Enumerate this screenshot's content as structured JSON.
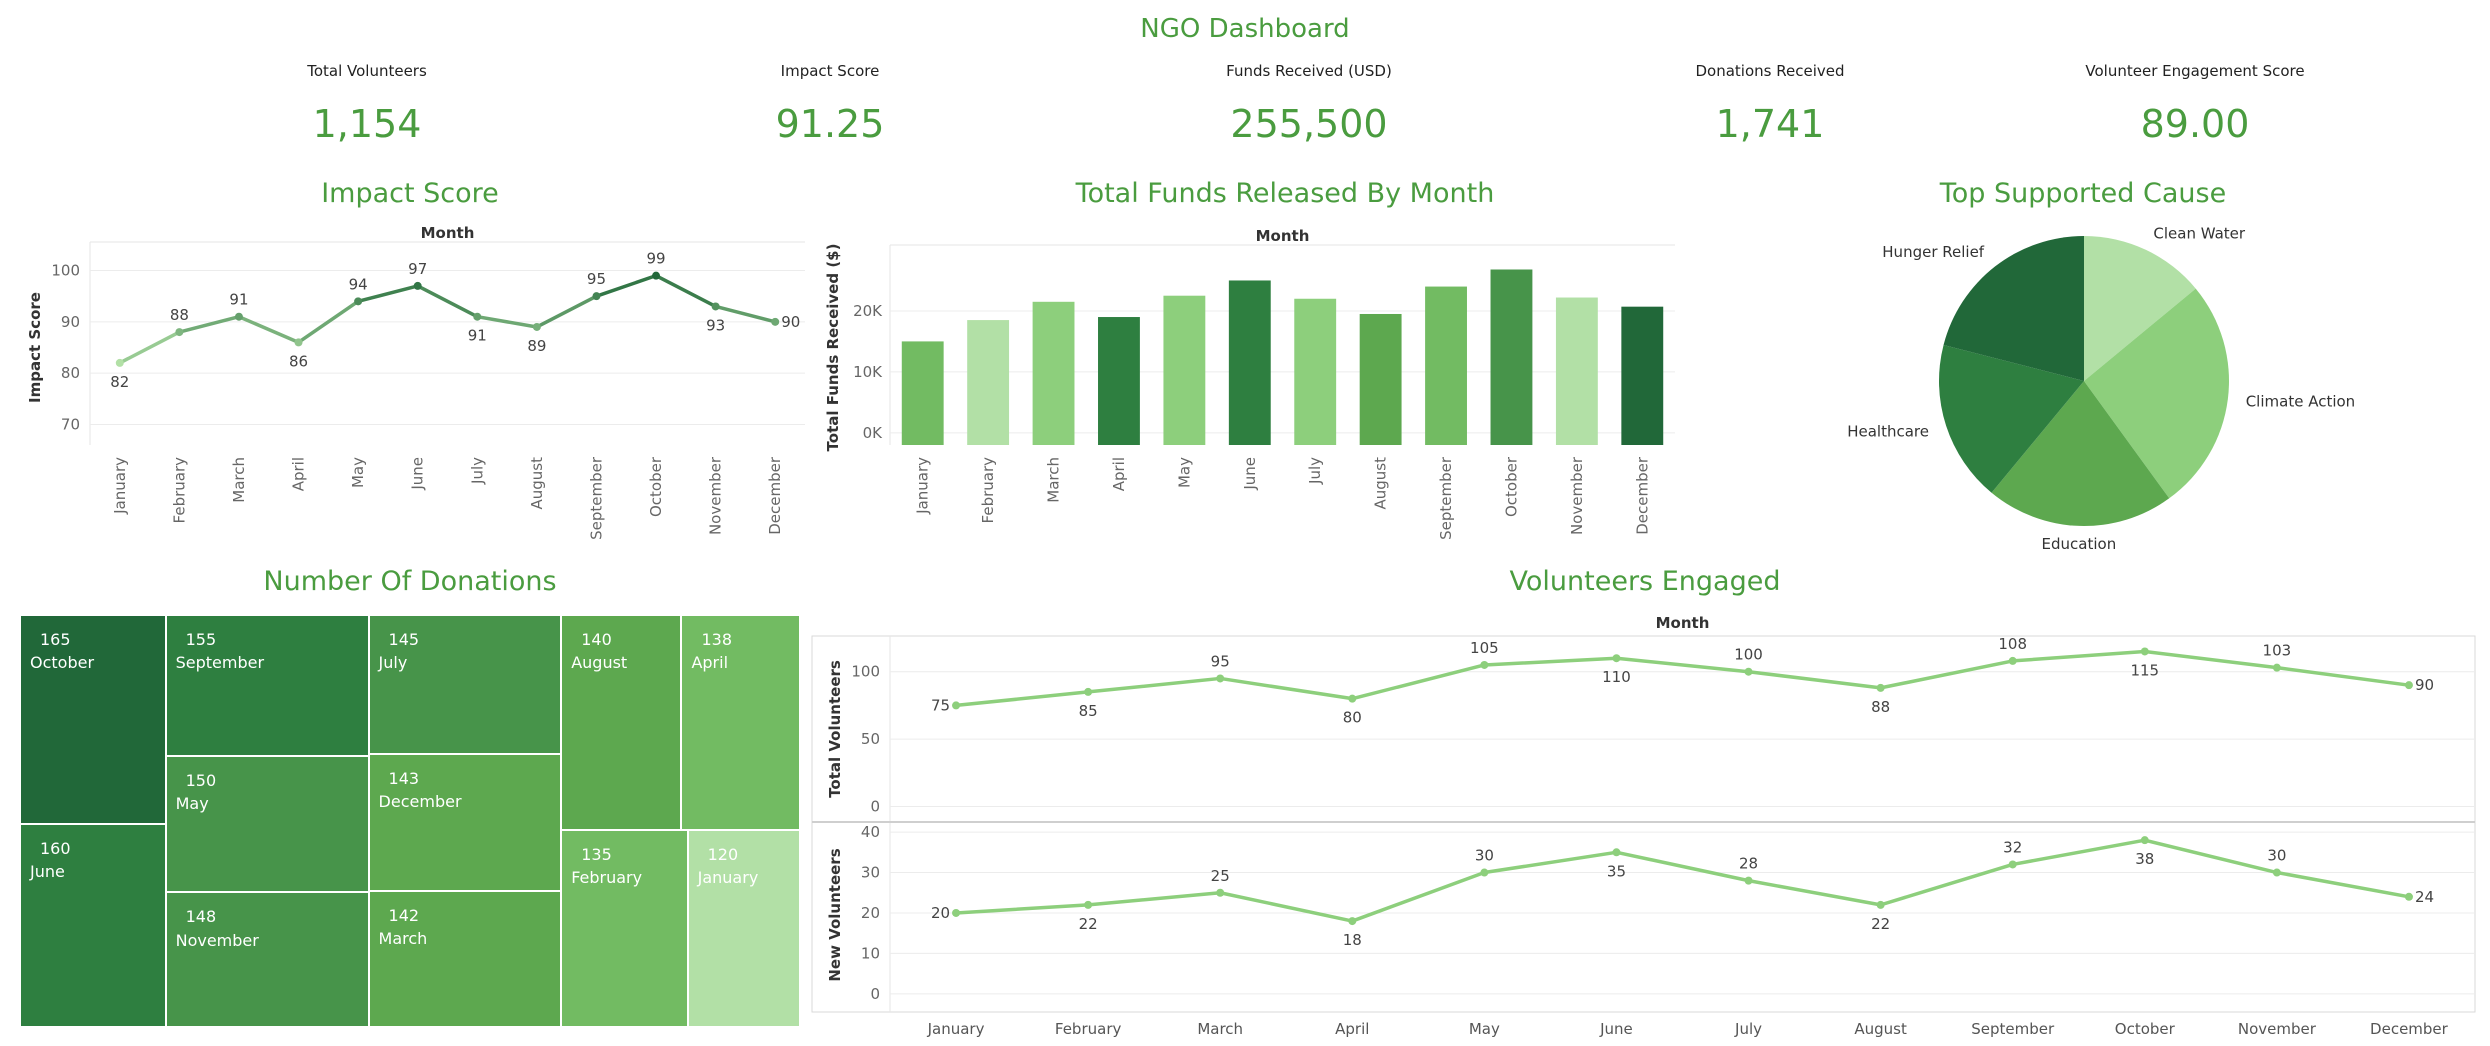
{
  "dashboard": {
    "title": "NGO Dashboard"
  },
  "kpis": [
    {
      "label": "Total Volunteers",
      "value": "1,154"
    },
    {
      "label": "Impact Score",
      "value": "91.25"
    },
    {
      "label": "Funds Received (USD)",
      "value": "255,500"
    },
    {
      "label": "Donations Received",
      "value": "1,741"
    },
    {
      "label": "Volunteer Engagement Score",
      "value": "89.00"
    }
  ],
  "palette": {
    "accent": "#4a9c3f",
    "g1": "#b2e0a6",
    "g2": "#8dcf7c",
    "g3": "#72bb62",
    "g4": "#5da84f",
    "g5": "#47944a",
    "g6": "#2e7f40",
    "g7": "#216839"
  },
  "chart_data": [
    {
      "id": "impact",
      "type": "line",
      "title": "Impact Score",
      "xlabel": "Month",
      "ylabel": "Impact Score",
      "categories": [
        "January",
        "February",
        "March",
        "April",
        "May",
        "June",
        "July",
        "August",
        "September",
        "October",
        "November",
        "December"
      ],
      "values": [
        82,
        88,
        91,
        86,
        94,
        97,
        91,
        89,
        95,
        99,
        93,
        90
      ],
      "ylim": [
        66,
        104
      ],
      "yticks": [
        70,
        80,
        90,
        100
      ],
      "grid": true
    },
    {
      "id": "funds",
      "type": "bar",
      "title": "Total Funds Released By Month",
      "xlabel": "Month",
      "ylabel": "Total Funds Received ($)",
      "categories": [
        "January",
        "February",
        "March",
        "April",
        "May",
        "June",
        "July",
        "August",
        "September",
        "October",
        "November",
        "December"
      ],
      "values": [
        15000,
        18500,
        21500,
        19000,
        22500,
        25000,
        22000,
        19500,
        24000,
        26800,
        22200,
        20700
      ],
      "ylim": [
        -2000,
        30000
      ],
      "yticks": [
        0,
        10000,
        20000
      ],
      "ytick_labels": [
        "0K",
        "10K",
        "20K"
      ],
      "colors": [
        "#72bb62",
        "#b2e0a6",
        "#8dcf7c",
        "#2e7f40",
        "#8dcf7c",
        "#2e7f40",
        "#8dcf7c",
        "#5da84f",
        "#72bb62",
        "#47944a",
        "#b2e0a6",
        "#216839"
      ]
    },
    {
      "id": "cause",
      "type": "pie",
      "title": "Top Supported Cause",
      "slices": [
        {
          "label": "Clean Water",
          "value": 14,
          "color": "#b2e0a6"
        },
        {
          "label": "Climate Action",
          "value": 26,
          "color": "#8dcf7c"
        },
        {
          "label": "Education",
          "value": 21,
          "color": "#5da84f"
        },
        {
          "label": "Healthcare",
          "value": 18,
          "color": "#2e7f40"
        },
        {
          "label": "Hunger Relief",
          "value": 21,
          "color": "#216839"
        }
      ]
    },
    {
      "id": "donations",
      "type": "treemap",
      "title": "Number Of Donations",
      "items": [
        {
          "label": "October",
          "value": 165,
          "color": "#216839"
        },
        {
          "label": "June",
          "value": 160,
          "color": "#2e7f40"
        },
        {
          "label": "September",
          "value": 155,
          "color": "#2e7f40"
        },
        {
          "label": "May",
          "value": 150,
          "color": "#47944a"
        },
        {
          "label": "November",
          "value": 148,
          "color": "#47944a"
        },
        {
          "label": "July",
          "value": 145,
          "color": "#47944a"
        },
        {
          "label": "December",
          "value": 143,
          "color": "#5da84f"
        },
        {
          "label": "March",
          "value": 142,
          "color": "#5da84f"
        },
        {
          "label": "August",
          "value": 140,
          "color": "#5da84f"
        },
        {
          "label": "April",
          "value": 138,
          "color": "#72bb62"
        },
        {
          "label": "February",
          "value": 135,
          "color": "#72bb62"
        },
        {
          "label": "January",
          "value": 120,
          "color": "#b2e0a6"
        }
      ]
    },
    {
      "id": "volunteers",
      "type": "line",
      "title": "Volunteers Engaged",
      "xlabel": "Month",
      "categories": [
        "January",
        "February",
        "March",
        "April",
        "May",
        "June",
        "July",
        "August",
        "September",
        "October",
        "November",
        "December"
      ],
      "series": [
        {
          "name": "Total Volunteers",
          "values": [
            75,
            85,
            95,
            80,
            105,
            110,
            100,
            88,
            108,
            115,
            103,
            90
          ],
          "ylim": [
            -10,
            125
          ],
          "yticks": [
            0,
            50,
            100
          ]
        },
        {
          "name": "New Volunteers",
          "values": [
            20,
            22,
            25,
            18,
            30,
            35,
            28,
            22,
            32,
            38,
            30,
            24
          ],
          "ylim": [
            -3,
            42
          ],
          "yticks": [
            0,
            10,
            20,
            30,
            40
          ]
        }
      ],
      "color": "#8dcf7c"
    }
  ]
}
